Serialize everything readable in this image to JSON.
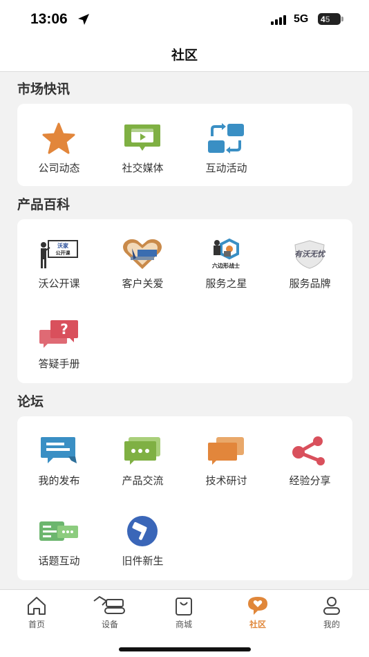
{
  "status": {
    "time": "13:06",
    "network": "5G",
    "battery_level": "4",
    "battery_rest": "5"
  },
  "header": {
    "title": "社区"
  },
  "sections": [
    {
      "title": "市场快讯",
      "items": [
        {
          "label": "公司动态",
          "icon": "star-icon"
        },
        {
          "label": "社交媒体",
          "icon": "video-icon"
        },
        {
          "label": "互动活动",
          "icon": "refresh-arrows-icon"
        }
      ]
    },
    {
      "title": "产品百科",
      "items": [
        {
          "label": "沃公开课",
          "icon": "open-class-icon",
          "icon_text": [
            "沃家",
            "公开课"
          ]
        },
        {
          "label": "客户关爱",
          "icon": "customer-care-icon"
        },
        {
          "label": "服务之星",
          "icon": "service-star-icon",
          "icon_text": "六边形战士"
        },
        {
          "label": "服务品牌",
          "icon": "service-brand-icon",
          "icon_text": "有沃无忧"
        },
        {
          "label": "答疑手册",
          "icon": "question-chat-icon"
        }
      ]
    },
    {
      "title": "论坛",
      "items": [
        {
          "label": "我的发布",
          "icon": "my-post-icon"
        },
        {
          "label": "产品交流",
          "icon": "chat-dots-icon"
        },
        {
          "label": "技术研讨",
          "icon": "discussion-icon"
        },
        {
          "label": "经验分享",
          "icon": "share-icon"
        },
        {
          "label": "话题互动",
          "icon": "topic-chat-icon"
        },
        {
          "label": "旧件新生",
          "icon": "hammer-icon"
        }
      ]
    }
  ],
  "tabs": [
    {
      "label": "首页",
      "icon": "home-icon",
      "active": false
    },
    {
      "label": "设备",
      "icon": "excavator-icon",
      "active": false
    },
    {
      "label": "商城",
      "icon": "shopping-bag-icon",
      "active": false
    },
    {
      "label": "社区",
      "icon": "community-icon",
      "active": true
    },
    {
      "label": "我的",
      "icon": "user-icon",
      "active": false
    }
  ],
  "colors": {
    "accent": "#e0873a",
    "blue": "#3a8fc4",
    "green": "#7fb043",
    "red": "#d9505c",
    "orange": "#e2863b"
  }
}
